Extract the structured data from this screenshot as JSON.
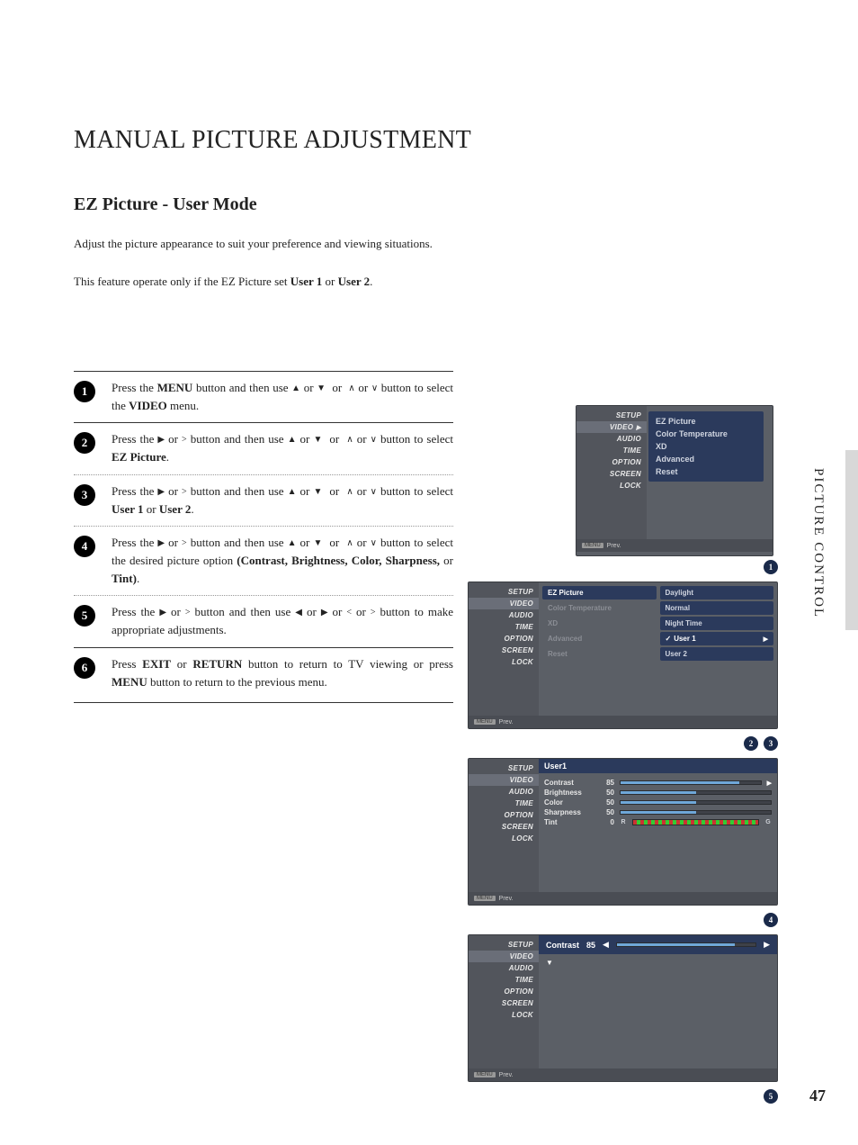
{
  "title": "MANUAL PICTURE ADJUSTMENT",
  "subtitle": "EZ Picture - User Mode",
  "intro1": "Adjust the picture appearance to suit your preference and viewing situations.",
  "intro2_a": "This feature operate only if the EZ Picture set ",
  "intro2_b": "User 1",
  "intro2_c": " or ",
  "intro2_d": "User 2",
  "intro2_e": ".",
  "steps": {
    "s1": {
      "press": "Press the ",
      "menu": "MENU",
      "mid": " button and then use ",
      "tail": " button to select the ",
      "video": "VIDEO",
      "end": " menu."
    },
    "s2": {
      "press": "Press the ",
      "mid": " button and then use ",
      "tail": " button to select ",
      "target": "EZ Picture",
      "end": "."
    },
    "s3": {
      "press": "Press the ",
      "mid": " button and then use ",
      "tail": " button to select ",
      "u1": "User 1",
      "or": " or ",
      "u2": "User 2",
      "end": "."
    },
    "s4": {
      "press": "Press the ",
      "mid": " button and then use ",
      "tail": " button to select the desired picture option ",
      "opts": "(Contrast, Brightness, Color, Sharpness,",
      "opts2": "Tint)",
      "end": "."
    },
    "s5": {
      "press": "Press the ",
      "mid": " button and then use ",
      "tail": " button to make appropriate adjustments."
    },
    "s6": {
      "press": "Press ",
      "exit": "EXIT",
      "or": " or ",
      "ret": "RETURN",
      "mid": " button to return to TV viewing or press ",
      "menu": "MENU",
      "end": " button to return to the previous menu."
    }
  },
  "side_label": "PICTURE CONTROL",
  "page_num": "47",
  "menu_side": [
    "SETUP",
    "VIDEO",
    "AUDIO",
    "TIME",
    "OPTION",
    "SCREEN",
    "LOCK"
  ],
  "osd1_sub": [
    "EZ Picture",
    "Color Temperature",
    "XD",
    "Advanced",
    "Reset"
  ],
  "osd2_left": [
    {
      "label": "EZ Picture",
      "sel": true
    },
    {
      "label": "Color Temperature",
      "sel": false
    },
    {
      "label": "XD",
      "sel": false
    },
    {
      "label": "Advanced",
      "sel": false
    },
    {
      "label": "Reset",
      "sel": false
    }
  ],
  "osd2_right": [
    {
      "label": "Daylight",
      "check": false,
      "arrow": false
    },
    {
      "label": "Normal",
      "check": false,
      "arrow": false
    },
    {
      "label": "Night Time",
      "check": false,
      "arrow": false
    },
    {
      "label": "User 1",
      "check": true,
      "arrow": true
    },
    {
      "label": "User 2",
      "check": false,
      "arrow": false
    }
  ],
  "osd3_header": "User1",
  "osd3_rows": [
    {
      "label": "Contrast",
      "val": "85",
      "pct": 85
    },
    {
      "label": "Brightness",
      "val": "50",
      "pct": 50
    },
    {
      "label": "Color",
      "val": "50",
      "pct": 50
    },
    {
      "label": "Sharpness",
      "val": "50",
      "pct": 50
    }
  ],
  "osd3_tint": {
    "label": "Tint",
    "val": "0",
    "capL": "R",
    "capR": "G"
  },
  "osd4": {
    "label": "Contrast",
    "val": "85",
    "pct": 85
  },
  "badges": {
    "b1": "1",
    "b2": "2",
    "b3": "3",
    "b4": "4",
    "b5": "5"
  },
  "footer": {
    "menu": "MENU",
    "prev": "Prev."
  },
  "glyph": {
    "up": "▲",
    "down": "▼",
    "left": "◀",
    "right": "▶",
    "caretUp": "∧",
    "caretDown": "∨",
    "caretLeft": "<",
    "caretRight": ">"
  }
}
